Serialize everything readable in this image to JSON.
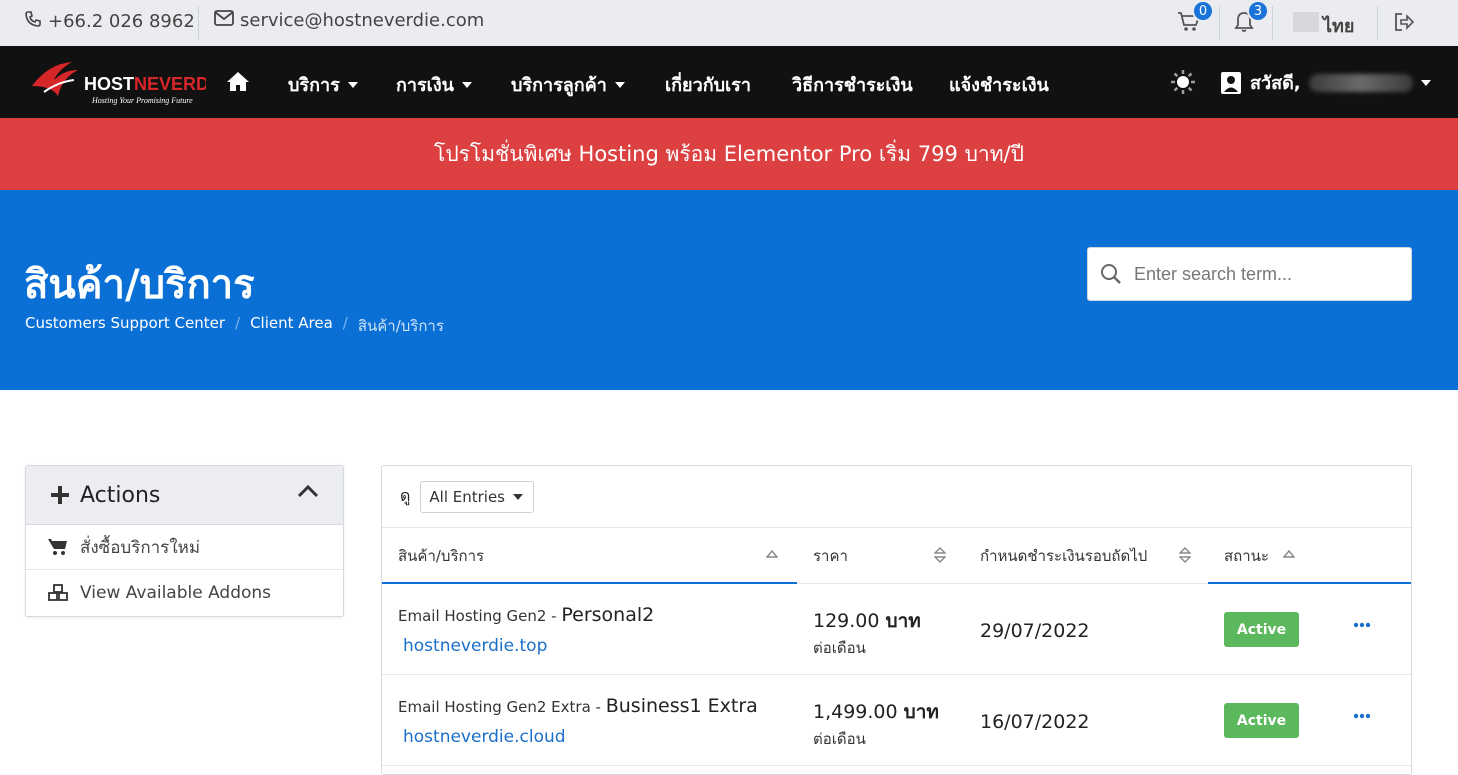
{
  "topbar": {
    "phone": "+66.2 026 8962",
    "email": "service@hostneverdie.com",
    "cart_count": "0",
    "notif_count": "3",
    "language": "ไทย"
  },
  "nav": {
    "logo_text": "HOSTNEVERDIE",
    "logo_tagline": "Hosting Your Promising Future",
    "items": [
      {
        "label": "บริการ",
        "dropdown": true
      },
      {
        "label": "การเงิน",
        "dropdown": true
      },
      {
        "label": "บริการลูกค้า",
        "dropdown": true
      },
      {
        "label": "เกี่ยวกับเรา",
        "dropdown": false
      },
      {
        "label": "วิธีการชำระเงิน",
        "dropdown": false
      },
      {
        "label": "แจ้งชำระเงิน",
        "dropdown": false
      }
    ],
    "greeting": "สวัสดี,"
  },
  "promo": {
    "text": "โปรโมชั่นพิเศษ Hosting พร้อม Elementor Pro เริ่ม 799 บาท/ปี"
  },
  "hero": {
    "title": "สินค้า/บริการ",
    "breadcrumb": [
      "Customers Support Center",
      "Client Area",
      "สินค้า/บริการ"
    ],
    "search_placeholder": "Enter search term..."
  },
  "actions": {
    "title": "Actions",
    "items": [
      {
        "label": "สั่งซื้อบริการใหม่",
        "icon": "cart-icon"
      },
      {
        "label": "View Available Addons",
        "icon": "cubes-icon"
      }
    ]
  },
  "table": {
    "show_label": "ดู",
    "entries_select": "All Entries",
    "columns": [
      "สินค้า/บริการ",
      "ราคา",
      "กำหนดชำระเงินรอบถัดไป",
      "สถานะ"
    ],
    "rows": [
      {
        "group": "Email Hosting Gen2",
        "plan": "Personal2",
        "domain": "hostneverdie.top",
        "price": "129.00",
        "currency": "บาท",
        "period": "ต่อเดือน",
        "due": "29/07/2022",
        "status": "Active"
      },
      {
        "group": "Email Hosting Gen2 Extra",
        "plan": "Business1 Extra",
        "domain": "hostneverdie.cloud",
        "price": "1,499.00",
        "currency": "บาท",
        "period": "ต่อเดือน",
        "due": "16/07/2022",
        "status": "Active"
      }
    ]
  },
  "colors": {
    "nav_bg": "#111111",
    "promo_bg": "#dc4040",
    "hero_bg": "#0a70d6",
    "active": "#5cb85c",
    "link": "#1a6fc9"
  }
}
